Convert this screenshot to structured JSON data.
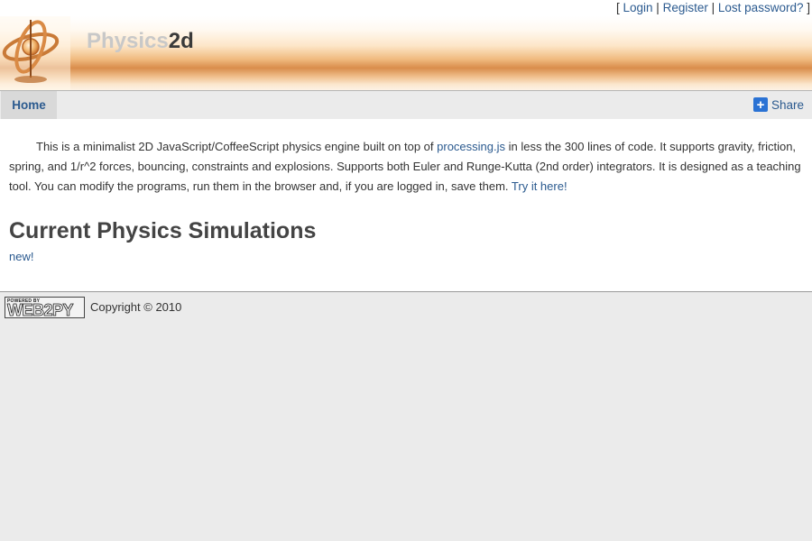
{
  "topbar": {
    "open_bracket": "[",
    "login": "Login",
    "sep1": "|",
    "register": "Register",
    "sep2": "|",
    "lost_password": "Lost password?",
    "close_bracket": "]"
  },
  "header": {
    "logo_part1": "Physics",
    "logo_part2": "2d"
  },
  "nav": {
    "home": "Home",
    "share": "Share",
    "share_icon": "+"
  },
  "main": {
    "intro_1": "This is a minimalist 2D JavaScript/CoffeeScript physics engine built on top of ",
    "intro_link": "processing.js",
    "intro_2": " in less the 300 lines of code. It supports gravity, friction, spring, and 1/r^2 forces, bouncing, constraints and explosions. Supports both Euler and Runge-Kutta (2nd order) integrators. It is designed as a teaching tool. You can modify the programs, run them in the browser and, if you are logged in, save them. ",
    "try_link": "Try it here!",
    "section_title": "Current Physics Simulations",
    "new_link": "new!"
  },
  "footer": {
    "badge_small": "POWERED BY",
    "badge_text": "WEB2PY",
    "copyright": "Copyright © 2010"
  },
  "colors": {
    "link": "#2b5a8f",
    "share_icon_bg": "#2a72d4",
    "page_bg": "#ebebeb"
  }
}
